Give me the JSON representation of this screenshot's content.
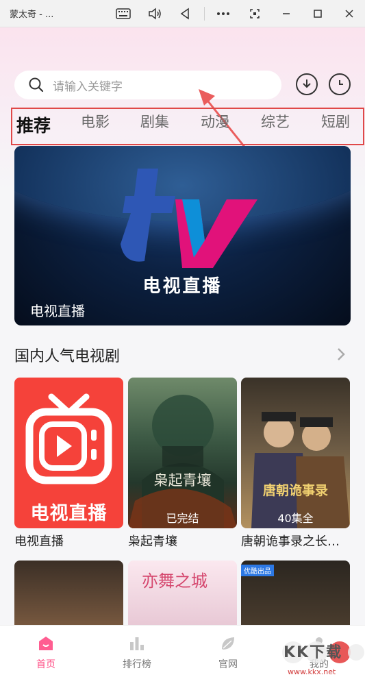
{
  "window": {
    "title": "蒙太奇 - ..."
  },
  "search": {
    "placeholder": "请输入关键字"
  },
  "tabs": [
    {
      "label": "推荐"
    },
    {
      "label": "电影"
    },
    {
      "label": "剧集"
    },
    {
      "label": "动漫"
    },
    {
      "label": "综艺"
    },
    {
      "label": "短剧"
    }
  ],
  "banner": {
    "logo_text": "电视直播",
    "caption": "电视直播"
  },
  "section": {
    "title": "国内人气电视剧"
  },
  "posters": [
    {
      "title": "电视直播",
      "art_text": "电视直播",
      "badge": ""
    },
    {
      "title": "枭起青壤",
      "art_text": "枭起青壤",
      "badge": "已完结"
    },
    {
      "title": "唐朝诡事录之长…",
      "art_text": "唐朝诡事录",
      "badge": "40集全"
    }
  ],
  "second_row": [
    {
      "tag": ""
    },
    {
      "tag": ""
    },
    {
      "tag": "优酷出品"
    }
  ],
  "bottom_nav": [
    {
      "label": "首页",
      "icon": "home-icon",
      "active": true
    },
    {
      "label": "排行榜",
      "icon": "ranking-icon",
      "active": false
    },
    {
      "label": "官网",
      "icon": "leaf-icon",
      "active": false
    },
    {
      "label": "我的",
      "icon": "profile-icon",
      "active": false
    }
  ],
  "watermark": {
    "text": "KK下载",
    "url": "www.kkx.net"
  },
  "colors": {
    "accent_pink": "#ff4f86",
    "highlight_red": "#e04848"
  }
}
